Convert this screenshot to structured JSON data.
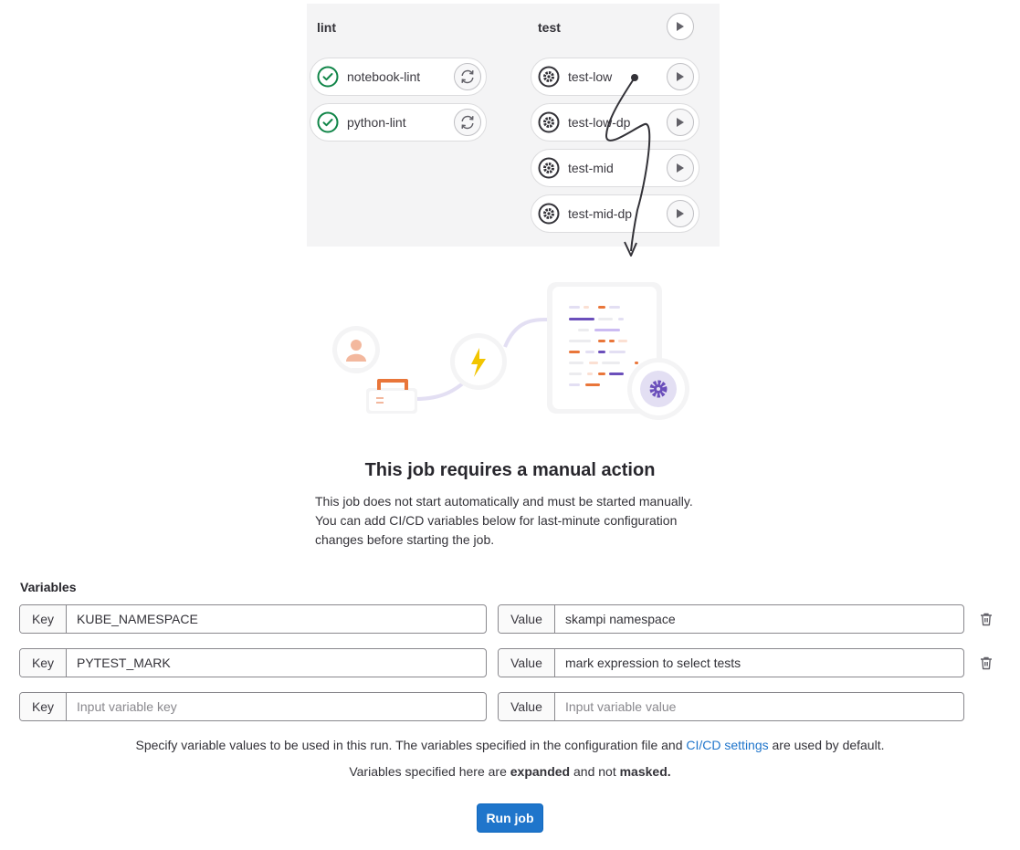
{
  "pipeline": {
    "stages": [
      {
        "name": "lint",
        "jobs": [
          {
            "name": "notebook-lint",
            "status": "passed",
            "action": "retry"
          },
          {
            "name": "python-lint",
            "status": "passed",
            "action": "retry"
          }
        ]
      },
      {
        "name": "test",
        "jobs": [
          {
            "name": "test-low",
            "status": "manual",
            "action": "play"
          },
          {
            "name": "test-low-dp",
            "status": "manual",
            "action": "play"
          },
          {
            "name": "test-mid",
            "status": "manual",
            "action": "play"
          },
          {
            "name": "test-mid-dp",
            "status": "manual",
            "action": "play"
          }
        ]
      }
    ]
  },
  "empty_state": {
    "title": "This job requires a manual action",
    "description": "This job does not start automatically and must be started manually. You can add CI/CD variables below for last-minute configuration changes before starting the job."
  },
  "variables": {
    "label": "Variables",
    "key_addon": "Key",
    "value_addon": "Value",
    "rows": [
      {
        "key": "KUBE_NAMESPACE",
        "value": "skampi namespace"
      },
      {
        "key": "PYTEST_MARK",
        "value": "mark expression to select tests"
      }
    ],
    "new_row": {
      "key_placeholder": "Input variable key",
      "value_placeholder": "Input variable value"
    }
  },
  "help": {
    "line1_before": "Specify variable values to be used in this run. The variables specified in the configuration file and ",
    "line1_link": "CI/CD settings",
    "line1_after": " are used by default.",
    "line2_before": "Variables specified here are ",
    "line2_bold1": "expanded",
    "line2_middle": " and not ",
    "line2_bold2": "masked."
  },
  "run_button": "Run job",
  "colors": {
    "primary": "#1f75cb",
    "success": "#108548",
    "accent_orange": "#e9763a",
    "accent_purple": "#6b4fbb"
  }
}
